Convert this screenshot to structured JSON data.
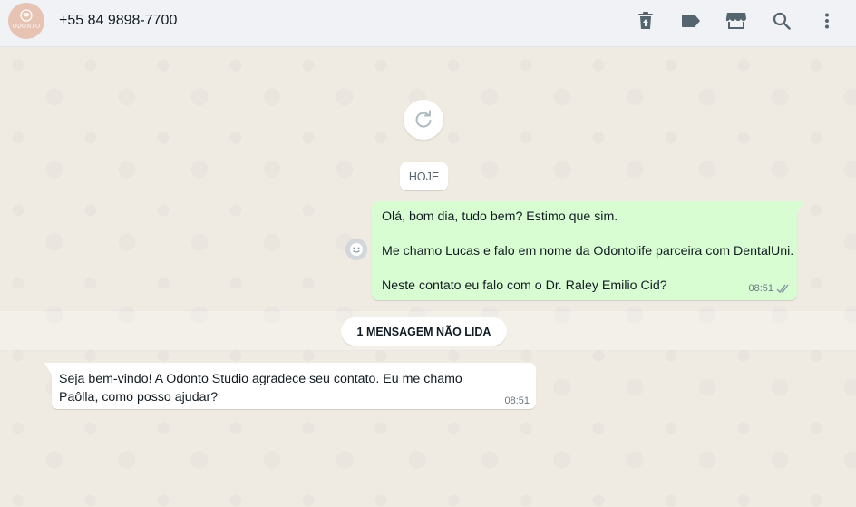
{
  "header": {
    "avatar_text": "ODONTO",
    "contact_name": "+55 84 9898-7700",
    "icons": [
      "delete-icon",
      "label-icon",
      "store-icon",
      "search-icon",
      "menu-icon"
    ]
  },
  "chat": {
    "date_chip": "HOJE",
    "outgoing": {
      "lines": [
        "Olá, bom dia, tudo bem? Estimo que sim.",
        "Me chamo Lucas e falo em nome da Odontolife parceira com DentalUni.",
        "Neste contato eu falo com o Dr. Raley Emilio Cid?"
      ],
      "time": "08:51",
      "status": "read"
    },
    "unread_label": "1 MENSAGEM NÃO LIDA",
    "incoming": {
      "text": "Seja bem-vindo! A Odonto Studio agradece seu contato. Eu me chamo Paôlla, como posso ajudar?",
      "time": "08:51"
    }
  },
  "colors": {
    "outgoing_bubble": "#d9fdd3",
    "incoming_bubble": "#ffffff",
    "chat_background": "#efeae2",
    "header_background": "#f0f2f5"
  }
}
